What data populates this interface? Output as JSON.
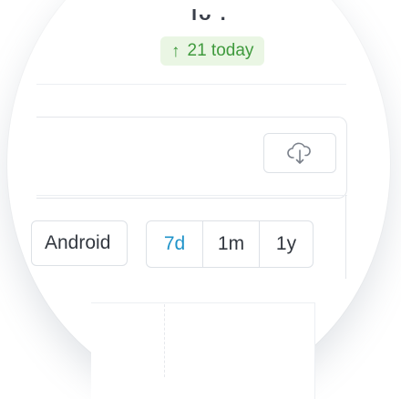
{
  "header": {
    "partial_text": "ıᴗ ."
  },
  "stats": {
    "today_label": "21 today",
    "arrow_icon": "arrow-up-icon",
    "accent": "#3f9a3d"
  },
  "toolbar": {
    "cloud_icon": "cloud-download-icon"
  },
  "filters": {
    "platform": "Android",
    "ranges": [
      "7d",
      "1m",
      "1y"
    ],
    "active_range": "7d",
    "active_color": "#1f93c9"
  }
}
